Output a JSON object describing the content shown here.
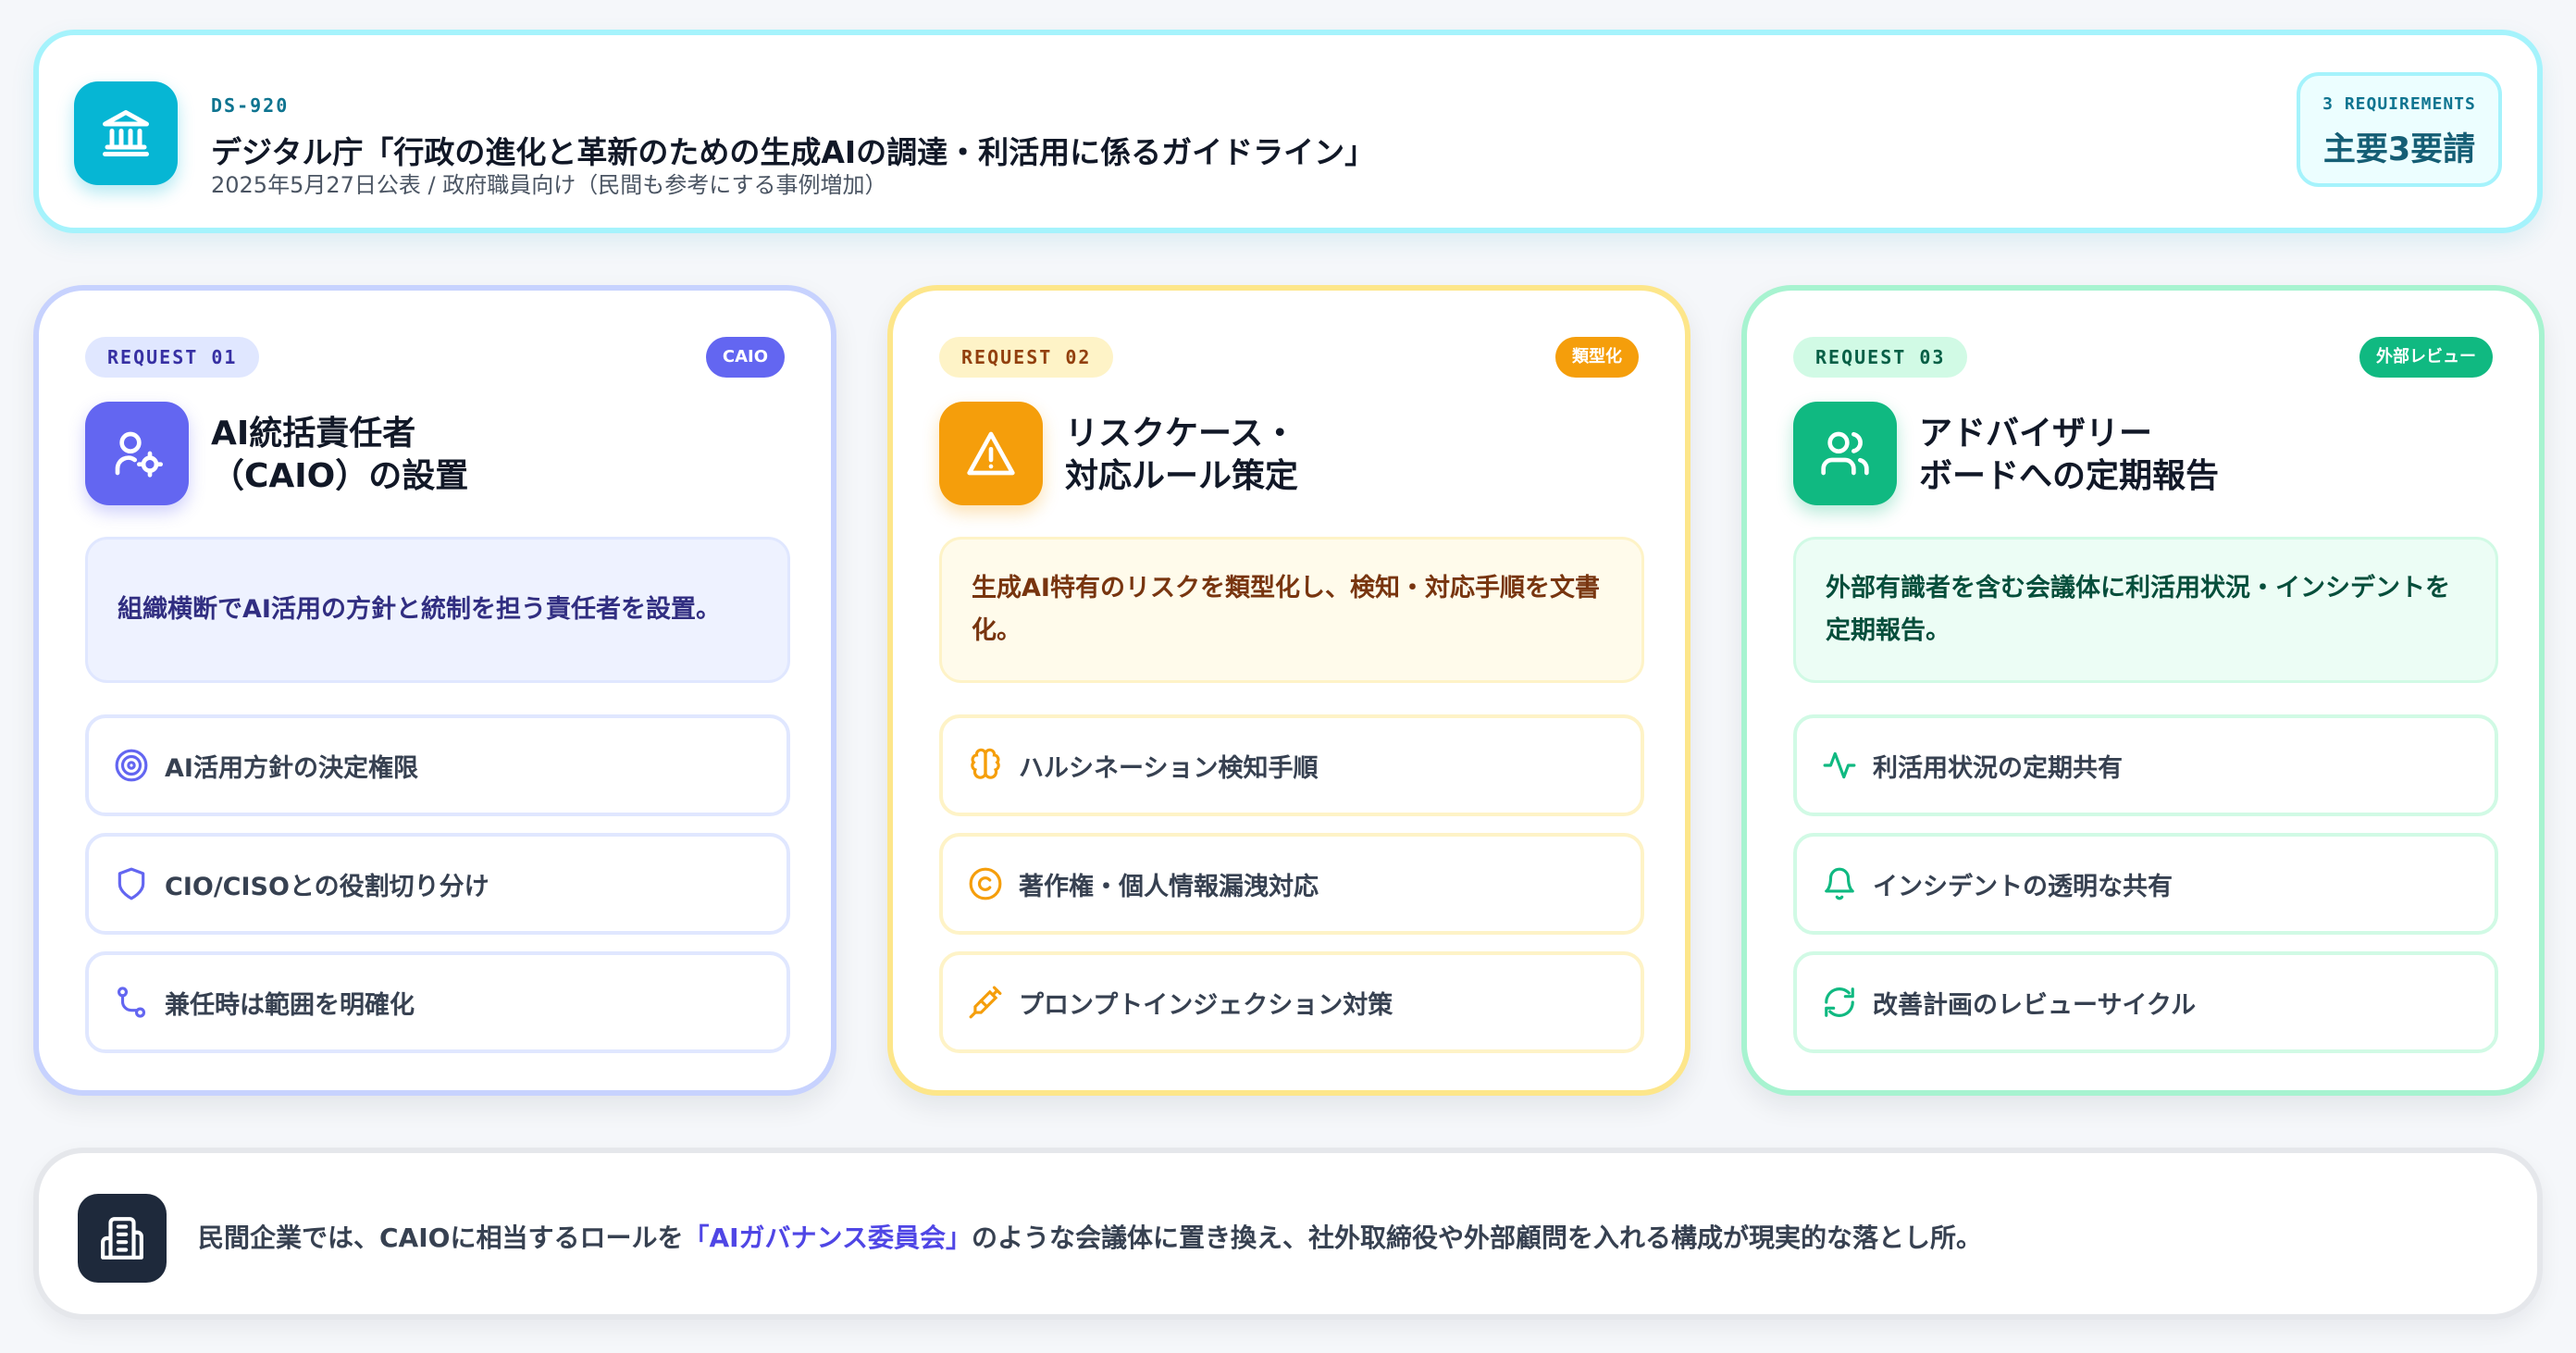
{
  "header": {
    "code": "DS-920",
    "title": "デジタル庁「行政の進化と革新のための生成AIの調達・利活用に係るガイドライン」",
    "subtitle": "2025年5月27日公表 / 政府職員向け（民間も参考にする事例増加）",
    "requirements_label": "3 REQUIREMENTS",
    "requirements_value": "主要3要請",
    "icon": "bank-icon"
  },
  "cards": [
    {
      "tag": "REQUEST 01",
      "badge": "CAIO",
      "icon": "user-gear-icon",
      "title": "AI統括責任者\n（CAIO）の設置",
      "description": "組織横断でAI活用の方針と統制を担う責任者を設置。",
      "items": [
        {
          "label": "AI活用方針の決定権限",
          "icon": "target-icon"
        },
        {
          "label": "CIO/CISOとの役割切り分け",
          "icon": "shield-icon"
        },
        {
          "label": "兼任時は範囲を明確化",
          "icon": "route-icon"
        }
      ],
      "colors": {
        "accent": "#6366f1"
      }
    },
    {
      "tag": "REQUEST 02",
      "badge": "類型化",
      "icon": "warning-icon",
      "title": "リスクケース・\n対応ルール策定",
      "description": "生成AI特有のリスクを類型化し、検知・対応手順を文書化。",
      "items": [
        {
          "label": "ハルシネーション検知手順",
          "icon": "brain-icon"
        },
        {
          "label": "著作権・個人情報漏洩対応",
          "icon": "copyright-icon"
        },
        {
          "label": "プロンプトインジェクション対策",
          "icon": "syringe-icon"
        }
      ],
      "colors": {
        "accent": "#f59e0b"
      }
    },
    {
      "tag": "REQUEST 03",
      "badge": "外部レビュー",
      "icon": "users-icon",
      "title": "アドバイザリー\nボードへの定期報告",
      "description": "外部有識者を含む会議体に利活用状況・インシデントを定期報告。",
      "items": [
        {
          "label": "利活用状況の定期共有",
          "icon": "activity-icon"
        },
        {
          "label": "インシデントの透明な共有",
          "icon": "bell-icon"
        },
        {
          "label": "改善計画のレビューサイクル",
          "icon": "refresh-icon"
        }
      ],
      "colors": {
        "accent": "#10b981"
      }
    }
  ],
  "footer": {
    "icon": "building-icon",
    "text_before": "民間企業では、CAIOに相当するロールを",
    "highlight": "「AIガバナンス委員会」",
    "text_after": "のような会議体に置き換え、社外取締役や外部顧問を入れる構成が現実的な落とし所。"
  }
}
